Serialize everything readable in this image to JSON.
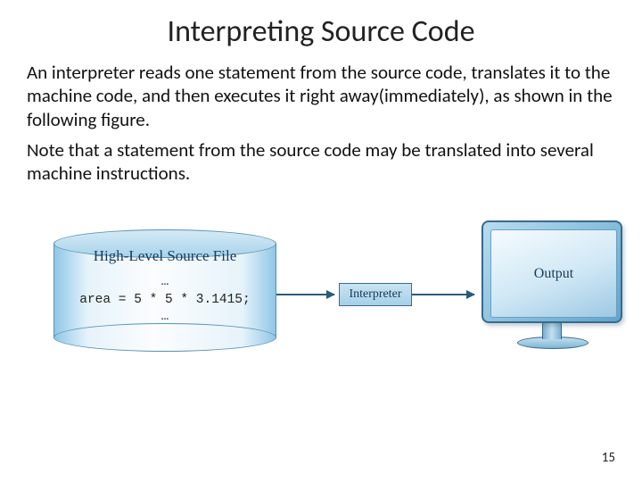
{
  "title": "Interpreting Source Code",
  "paragraph1": "An interpreter reads one statement from the source code, translates it to the machine code, and then executes it right away(immediately), as shown in the following figure.",
  "paragraph2": "Note that a statement from the source code may be translated into several machine instructions.",
  "diagram": {
    "source_file_label": "High-Level Source File",
    "code_line1": "…",
    "code_line2": "area = 5 * 5 * 3.1415;",
    "code_line3": "…",
    "interpreter_label": "Interpreter",
    "output_label": "Output"
  },
  "page_number": "15"
}
